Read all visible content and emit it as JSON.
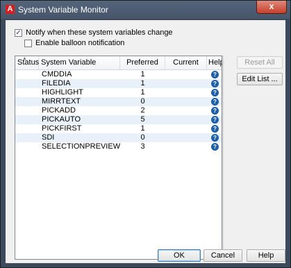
{
  "window": {
    "title": "System Variable Monitor",
    "close_glyph": "x"
  },
  "options": {
    "notify_label": "Notify when these system variables change",
    "notify_checked": true,
    "balloon_label": "Enable balloon notification",
    "balloon_checked": false
  },
  "table": {
    "columns": [
      "Status",
      "System Variable",
      "Preferred",
      "Current",
      "Help"
    ],
    "rows": [
      {
        "status": "",
        "variable": "CMDDIA",
        "preferred": "1",
        "current": ""
      },
      {
        "status": "",
        "variable": "FILEDIA",
        "preferred": "1",
        "current": ""
      },
      {
        "status": "",
        "variable": "HIGHLIGHT",
        "preferred": "1",
        "current": ""
      },
      {
        "status": "",
        "variable": "MIRRTEXT",
        "preferred": "0",
        "current": ""
      },
      {
        "status": "",
        "variable": "PICKADD",
        "preferred": "2",
        "current": ""
      },
      {
        "status": "",
        "variable": "PICKAUTO",
        "preferred": "5",
        "current": ""
      },
      {
        "status": "",
        "variable": "PICKFIRST",
        "preferred": "1",
        "current": ""
      },
      {
        "status": "",
        "variable": "SDI",
        "preferred": "0",
        "current": ""
      },
      {
        "status": "",
        "variable": "SELECTIONPREVIEW",
        "preferred": "3",
        "current": ""
      }
    ],
    "help_icon": "help-question-icon",
    "help_glyph": "?"
  },
  "buttons": {
    "reset_all": "Reset All",
    "edit_list": "Edit List ...",
    "ok": "OK",
    "cancel": "Cancel",
    "help": "Help"
  },
  "colors": {
    "titlebar": "#4a5a6f",
    "close": "#c6402c",
    "row_alt": "#e8f0fa",
    "help_icon": "#1f5fa8"
  }
}
